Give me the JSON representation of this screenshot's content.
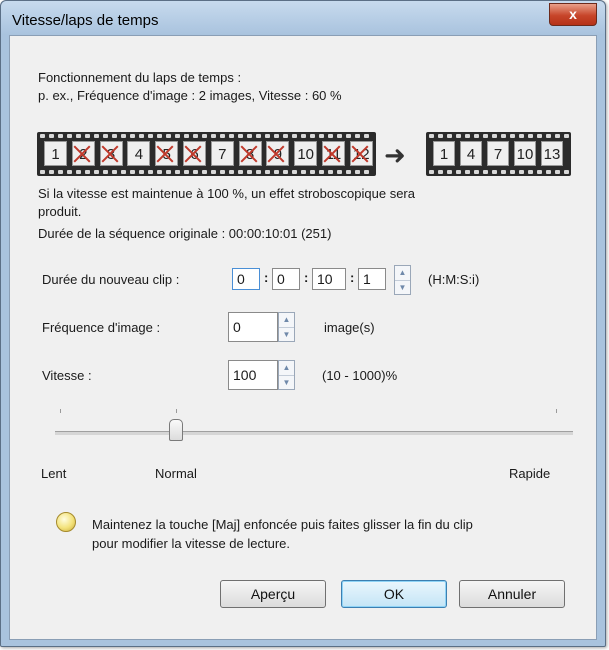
{
  "window": {
    "title": "Vitesse/laps de temps",
    "close_glyph": "x"
  },
  "info": {
    "line1": "Fonctionnement du laps de temps :",
    "line2": "p. ex., Fréquence d'image : 2 images, Vitesse : 60 %"
  },
  "film_source": {
    "frames": [
      "1",
      "2",
      "3",
      "4",
      "5",
      "6",
      "7",
      "8",
      "9",
      "10",
      "11",
      "12"
    ],
    "crossed": [
      2,
      3,
      5,
      6,
      8,
      9,
      11,
      12
    ]
  },
  "film_result": {
    "frames": [
      "1",
      "4",
      "7",
      "10",
      "13"
    ]
  },
  "arrow_glyph": "➜",
  "strobe_note_l1": "Si la vitesse est maintenue à 100 %, un effet stroboscopique sera",
  "strobe_note_l2": "produit.",
  "duration_original": "Durée de la séquence originale : 00:00:10:01 (251)",
  "new_clip": {
    "label": "Durée du nouveau clip :",
    "h": "0",
    "m": "0",
    "s": "10",
    "i": "1",
    "format": "(H:M:S:i)"
  },
  "frame_rate": {
    "label": "Fréquence d'image :",
    "value": "0",
    "unit": "image(s)"
  },
  "speed": {
    "label": "Vitesse :",
    "value": "100",
    "range": "(10 - 1000)%"
  },
  "slider": {
    "label_left": "Lent",
    "label_mid": "Normal",
    "label_right": "Rapide",
    "value_percent": 100
  },
  "hint": {
    "l1": "Maintenez la touche [Maj] enfoncée puis faites glisser la fin du clip",
    "l2": "pour modifier la vitesse de lecture."
  },
  "buttons": {
    "preview": "Aperçu",
    "ok": "OK",
    "cancel": "Annuler"
  },
  "colors": {
    "title_bar": "#a9c3de",
    "close": "#c7452a",
    "cross": "#c0392b",
    "focus": "#4a8fd6"
  },
  "icons": {
    "spin_up": "▲",
    "spin_down": "▼"
  }
}
